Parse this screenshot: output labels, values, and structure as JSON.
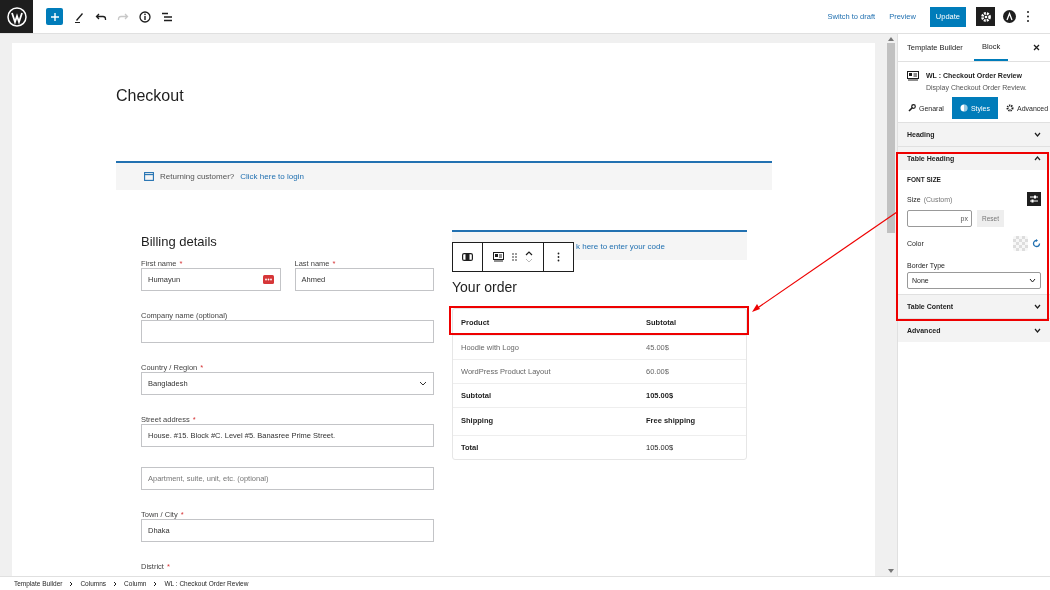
{
  "toolbar": {
    "history": [
      {
        "kind": "undo",
        "disabled": false
      },
      {
        "kind": "redo",
        "disabled": true
      }
    ],
    "switch_to_draft": "Switch to draft",
    "preview": "Preview",
    "update": "Update",
    "settings_active": true
  },
  "page": {
    "title": "Checkout",
    "notice": {
      "text": "Returning customer?",
      "link": "Click here to login"
    },
    "billing": {
      "heading": "Billing details",
      "rows": [
        [
          {
            "label": "First name",
            "mark": "*",
            "value": "Humayun",
            "kind": "text",
            "autofill_badge": true
          },
          {
            "label": "Last name",
            "mark": "*",
            "value": "Ahmed",
            "kind": "text"
          }
        ],
        [
          {
            "label": "Company name (optional)",
            "kind": "text"
          }
        ],
        [
          {
            "label": "Country / Region",
            "mark": "*",
            "value": "Bangladesh",
            "kind": "select"
          }
        ],
        [
          {
            "label": "Street address",
            "mark": "*",
            "value": "House. #15. Block #C. Level #5. Banasree Prime Street.",
            "kind": "text"
          }
        ],
        [
          {
            "placeholder": "Apartment, suite, unit, etc. (optional)",
            "kind": "text"
          }
        ],
        [
          {
            "label": "Town / City",
            "mark": "*",
            "value": "Dhaka",
            "kind": "text"
          }
        ],
        [
          {
            "label": "District",
            "mark": "*",
            "kind": "label"
          }
        ]
      ]
    },
    "order": {
      "coupon_link": "k here to enter your code",
      "heading": "Your order",
      "columns": [
        "Product",
        "Subtotal"
      ],
      "rows": [
        {
          "kind": "item",
          "cells": [
            "Hoodie with Logo",
            "45.00$"
          ]
        },
        {
          "kind": "item",
          "cells": [
            "WordPress Product Layout",
            "60.00$"
          ]
        },
        {
          "kind": "summary",
          "cells": [
            "Subtotal",
            "105.00$"
          ]
        },
        {
          "kind": "summary",
          "cells": [
            "Shipping",
            "Free shipping"
          ]
        },
        {
          "kind": "total",
          "cells": [
            "Total",
            "105.00$"
          ]
        }
      ]
    }
  },
  "sidebar": {
    "tabs": [
      {
        "label": "Template Builder",
        "selected": false
      },
      {
        "label": "Block",
        "selected": true
      }
    ],
    "block": {
      "title": "WL : Checkout Order Review",
      "description": "Display Checkout Order Review."
    },
    "style_tabs": [
      {
        "kind": "wrench",
        "label": "Genaral",
        "selected": false
      },
      {
        "kind": "styles",
        "label": "Styles",
        "selected": true
      },
      {
        "kind": "gear",
        "label": "Advanced",
        "selected": false
      }
    ],
    "panels": [
      {
        "title": "Heading",
        "expanded": false
      },
      {
        "title": "Table Heading",
        "expanded": true,
        "section_label": "FONT SIZE",
        "size_label": "Size",
        "size_hint": "(Custom)",
        "unit": "px",
        "reset": "Reset",
        "color_label": "Color",
        "border_label": "Border Type",
        "border_value": "None"
      },
      {
        "title": "Table Content",
        "expanded": false
      },
      {
        "title": "Advanced",
        "expanded": false
      }
    ]
  },
  "breadcrumb": [
    "Template Builder",
    "Columns",
    "Column",
    "WL : Checkout Order Review"
  ]
}
